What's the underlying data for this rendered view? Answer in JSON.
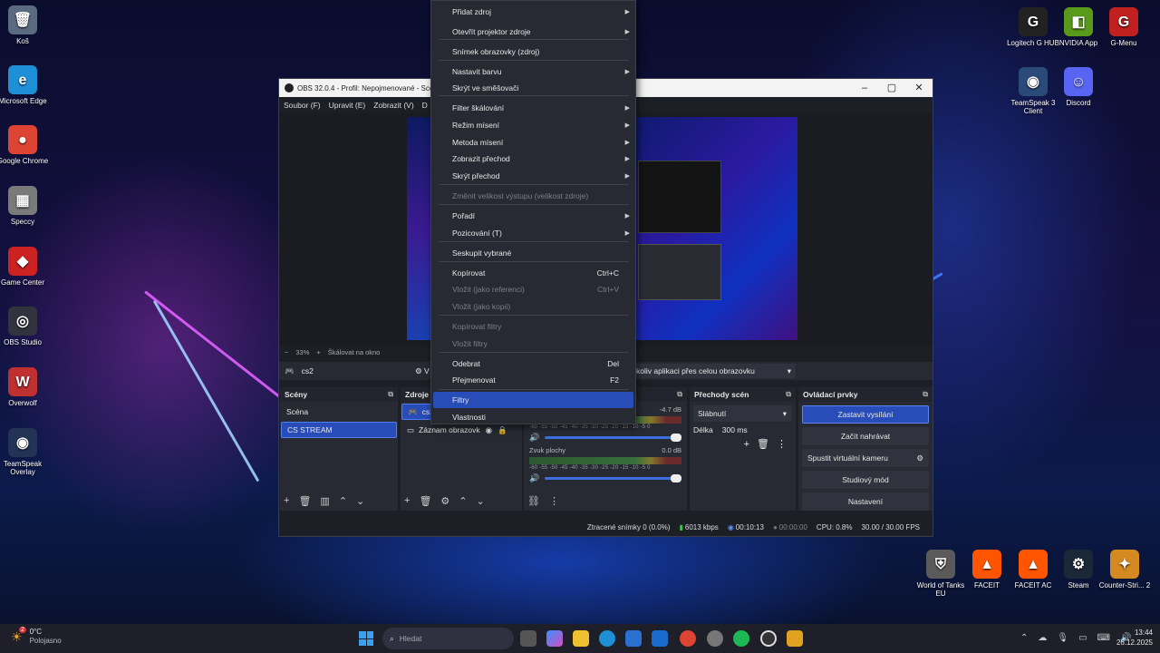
{
  "desktop_left": [
    {
      "label": "Koš",
      "glyph": "🗑",
      "color": "#5a6a80"
    },
    {
      "label": "Microsoft Edge",
      "glyph": "e",
      "color": "#1f8fd8"
    },
    {
      "label": "Google Chrome",
      "glyph": "●",
      "color": "#dd4433"
    },
    {
      "label": "Speccy",
      "glyph": "▦",
      "color": "#7a7a7a"
    },
    {
      "label": "Game Center",
      "glyph": "◆",
      "color": "#cc2222"
    },
    {
      "label": "OBS Studio",
      "glyph": "◎",
      "color": "#333340"
    },
    {
      "label": "Overwolf",
      "glyph": "W",
      "color": "#c03030"
    },
    {
      "label": "TeamSpeak Overlay",
      "glyph": "◉",
      "color": "#223355"
    }
  ],
  "desktop_right": [
    {
      "label": "Logitech G HUB",
      "glyph": "G",
      "color": "#222222"
    },
    {
      "label": "NVIDIA App",
      "glyph": "◧",
      "color": "#5a9a1a"
    },
    {
      "label": "G-Menu",
      "glyph": "G",
      "color": "#c02020"
    },
    {
      "label": "TeamSpeak 3 Client",
      "glyph": "◉",
      "color": "#2a4a7a"
    },
    {
      "label": "Discord",
      "glyph": "☺",
      "color": "#5865f2"
    }
  ],
  "desktop_bottom_right": [
    {
      "label": "World of Tanks EU",
      "glyph": "⛨",
      "color": "#5a5a5a"
    },
    {
      "label": "FACEIT",
      "glyph": "▲",
      "color": "#ff5500"
    },
    {
      "label": "FACEIT AC",
      "glyph": "▲",
      "color": "#ff5500"
    },
    {
      "label": "Steam",
      "glyph": "⚙",
      "color": "#1b2838"
    },
    {
      "label": "Counter-Stri... 2",
      "glyph": "✦",
      "color": "#d48a20"
    }
  ],
  "obs": {
    "title": "OBS 32.0.4 - Profil: Nepojmenované - Scé",
    "menu": [
      "Soubor (F)",
      "Upravit (E)",
      "Zobrazit (V)",
      "D"
    ],
    "zoom": [
      "−",
      "33%",
      "+",
      "Škálovat na okno",
      "▾"
    ],
    "source_name": "cs2",
    "source_settings_label": "V",
    "capture_mode": "koliv aplikaci přes celou obrazovku",
    "scenes": {
      "title": "Scény",
      "items": [
        "Scéna",
        "CS STREAM"
      ]
    },
    "sources": {
      "title": "Zdroje",
      "items": [
        "cs2",
        "Záznam obrazovk"
      ]
    },
    "mixer": {
      "channels": [
        {
          "name": "",
          "db": "-4.7 dB"
        },
        {
          "name": "Zvuk plochy",
          "db": "0.0 dB"
        }
      ],
      "scale": "-60 -55 -50 -45 -40 -35 -30 -25 -20 -15 -10 -5 0"
    },
    "transitions": {
      "title": "Přechody scén",
      "type": "Slábnutí",
      "duration_label": "Délka",
      "duration": "300 ms"
    },
    "controls": {
      "title": "Ovládací prvky",
      "buttons": [
        "Zastavit vysílání",
        "Začít nahrávat",
        "Spustit virtuální kameru",
        "Studiový mód",
        "Nastavení"
      ]
    },
    "status": {
      "dropped": "Ztracené snímky 0 (0.0%)",
      "bitrate": "6013 kbps",
      "stream_time": "00:10:13",
      "rec_time": "00:00:00",
      "cpu": "CPU: 0.8%",
      "fps": "30.00 / 30.00 FPS"
    }
  },
  "context_menu": {
    "items": [
      {
        "label": "Přidat zdroj",
        "submenu": true
      },
      {
        "label": "Otevřít projektor zdroje",
        "submenu": true
      },
      {
        "label": "Snímek obrazovky (zdroj)"
      },
      {
        "label": "Nastavit barvu",
        "submenu": true
      },
      {
        "label": "Skrýt ve směšovači"
      },
      {
        "label": "Filter škálování",
        "submenu": true
      },
      {
        "label": "Režim mísení",
        "submenu": true
      },
      {
        "label": "Metoda mísení",
        "submenu": true
      },
      {
        "label": "Zobrazit přechod",
        "submenu": true
      },
      {
        "label": "Skrýt přechod",
        "submenu": true
      },
      {
        "label": "Změnit velikost výstupu (velikost zdroje)",
        "disabled": true
      },
      {
        "label": "Pořadí",
        "submenu": true
      },
      {
        "label": "Pozicování (T)",
        "submenu": true
      },
      {
        "label": "Seskupit vybrané"
      },
      {
        "label": "Kopírovat",
        "shortcut": "Ctrl+C"
      },
      {
        "label": "Vložit (jako referenci)",
        "shortcut": "Ctrl+V",
        "disabled": true
      },
      {
        "label": "Vložit (jako kopii)",
        "disabled": true
      },
      {
        "label": "Kopírovat filtry",
        "disabled": true
      },
      {
        "label": "Vložit filtry",
        "disabled": true
      },
      {
        "label": "Odebrat",
        "shortcut": "Del"
      },
      {
        "label": "Přejmenovat",
        "shortcut": "F2"
      },
      {
        "label": "Filtry",
        "highlighted": true
      },
      {
        "label": "Vlastnosti"
      }
    ]
  },
  "taskbar": {
    "weather_temp": "0°C",
    "weather_text": "Polojasno",
    "weather_badge": "2",
    "search_placeholder": "Hledat",
    "time": "13:44",
    "date": "26.12.2025"
  }
}
